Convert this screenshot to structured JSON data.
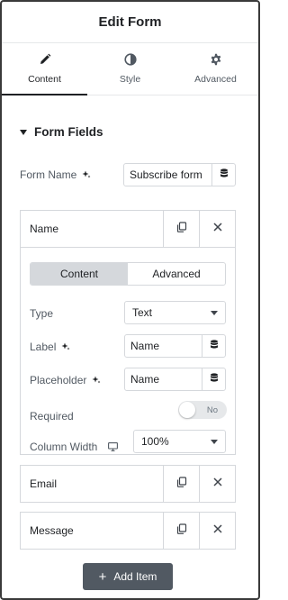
{
  "header": {
    "title": "Edit Form"
  },
  "tabs": [
    {
      "label": "Content",
      "icon": "pencil-icon",
      "active": true
    },
    {
      "label": "Style",
      "icon": "half-circle-icon",
      "active": false
    },
    {
      "label": "Advanced",
      "icon": "gear-icon",
      "active": false
    }
  ],
  "section": {
    "title": "Form Fields"
  },
  "form_name": {
    "label": "Form Name",
    "value": "Subscribe form"
  },
  "items": [
    {
      "title": "Name",
      "expanded": true,
      "subtabs": [
        "Content",
        "Advanced"
      ],
      "type": {
        "label": "Type",
        "value": "Text"
      },
      "field_label": {
        "label": "Label",
        "value": "Name"
      },
      "placeholder": {
        "label": "Placeholder",
        "value": "Name"
      },
      "required": {
        "label": "Required",
        "value": "No"
      },
      "column_width": {
        "label": "Column Width",
        "value": "100%"
      }
    },
    {
      "title": "Email"
    },
    {
      "title": "Message"
    }
  ],
  "add_item": {
    "label": "Add Item"
  },
  "colors": {
    "accent": "#515962",
    "border": "#d5d8dc",
    "active_segment": "#d5d8dc"
  }
}
